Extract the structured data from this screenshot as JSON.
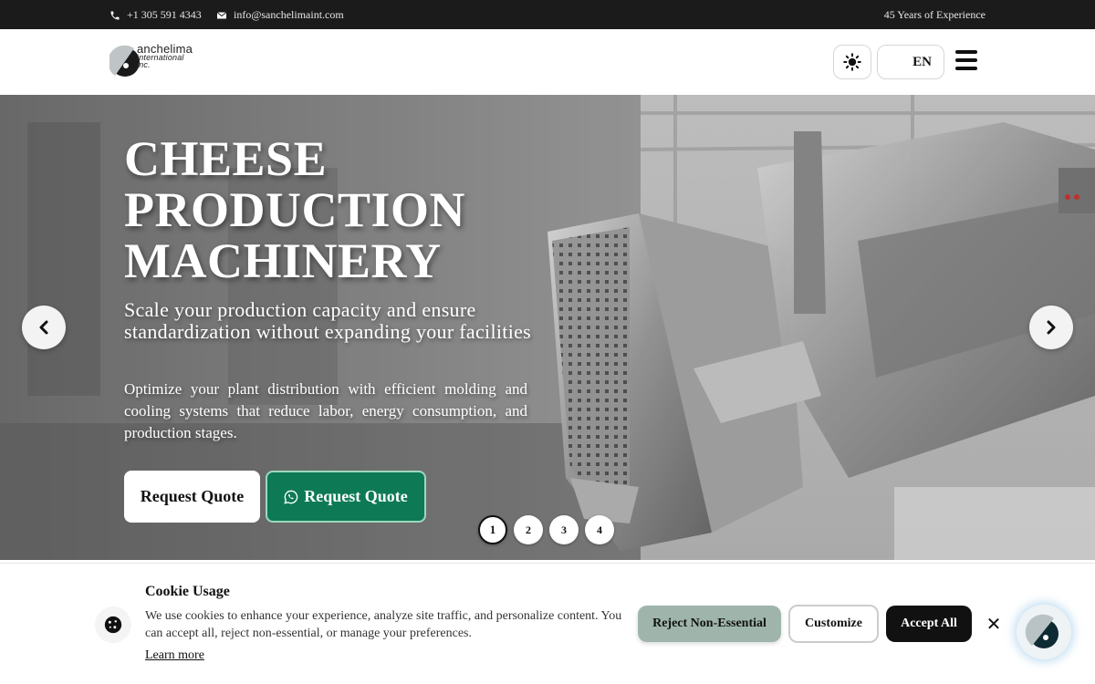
{
  "topbar": {
    "phone": "+1 305 591 4343",
    "email": "info@sanchelimaint.com",
    "experience": "45 Years of Experience"
  },
  "header": {
    "logo": {
      "line1": "anchelima",
      "line2": "international",
      "line3": "inc."
    },
    "language": "EN",
    "theme_icon": "sun-icon",
    "menu_icon": "hamburger-icon"
  },
  "hero": {
    "title": [
      "CHEESE",
      "PRODUCTION",
      "MACHINERY"
    ],
    "subtitle": "Scale your production capacity and ensure standardization without expanding your facilities",
    "description": "Optimize your plant distribution with efficient molding and cooling systems that reduce labor, energy consumption, and production stages.",
    "primary_button": "Request Quote",
    "whatsapp_button": "Request Quote",
    "slides": [
      "1",
      "2",
      "3",
      "4"
    ],
    "active_slide": "1"
  },
  "cookie": {
    "title": "Cookie Usage",
    "text": "We use cookies to enhance your experience, analyze site traffic, and personalize content. You can accept all, reject non-essential, or manage your preferences.",
    "learn_more": "Learn more",
    "reject": "Reject Non-Essential",
    "customize": "Customize",
    "accept": "Accept All"
  },
  "colors": {
    "topbar": "#1b1b1b",
    "whatsapp": "#0d7a55",
    "reject": "#9fb5ac",
    "accept": "#111111"
  }
}
